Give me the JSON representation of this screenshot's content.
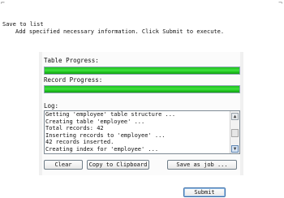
{
  "wizard": {
    "title": "Save to list",
    "subtitle": "Add specified necessary information. Click Submit to execute."
  },
  "progress": {
    "table_label": "Table Progress:",
    "table_value": 1.0,
    "record_label": "Record Progress:",
    "record_value": 1.0
  },
  "log": {
    "label": "Log:",
    "lines": [
      "Getting 'employee' table structure ...",
      "Creating table 'employee' ...",
      "Total records: 42",
      "Inserting records to 'employee' ...",
      "42 records inserted.",
      "Creating index for 'employee' ..."
    ]
  },
  "buttons": {
    "clear": "Clear",
    "copy": "Copy to Clipboard",
    "save_job": "Save as job ...",
    "submit": "Submit"
  },
  "icons": {
    "scroll_up": "▲",
    "scroll_down": "▼"
  }
}
